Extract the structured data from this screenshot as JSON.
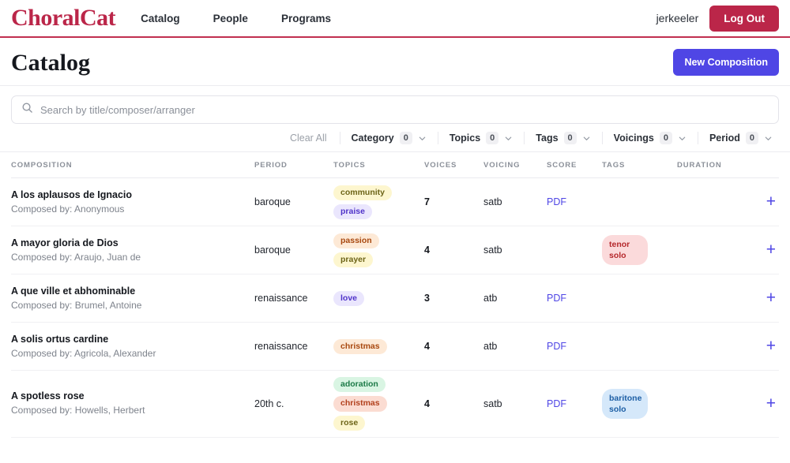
{
  "navbar": {
    "brand": "ChoralCat",
    "links": [
      {
        "label": "Catalog"
      },
      {
        "label": "People"
      },
      {
        "label": "Programs"
      }
    ],
    "username": "jerkeeler",
    "logout_label": "Log Out",
    "accent_color": "#bb2649"
  },
  "page": {
    "title": "Catalog",
    "new_button_label": "New Composition",
    "new_button_color": "#4f46e5"
  },
  "search": {
    "placeholder": "Search by title/composer/arranger",
    "value": "",
    "icon": "search-icon"
  },
  "filters": {
    "clear_all_label": "Clear All",
    "items": [
      {
        "label": "Category",
        "count": "0",
        "icon": "chevron-down-icon"
      },
      {
        "label": "Topics",
        "count": "0",
        "icon": "chevron-down-icon"
      },
      {
        "label": "Tags",
        "count": "0",
        "icon": "chevron-down-icon"
      },
      {
        "label": "Voicings",
        "count": "0",
        "icon": "chevron-down-icon"
      },
      {
        "label": "Period",
        "count": "0",
        "icon": "chevron-down-icon"
      }
    ]
  },
  "table": {
    "columns": [
      {
        "label": "COMPOSITION"
      },
      {
        "label": "PERIOD"
      },
      {
        "label": "TOPICS"
      },
      {
        "label": "VOICES"
      },
      {
        "label": "VOICING"
      },
      {
        "label": "SCORE"
      },
      {
        "label": "TAGS"
      },
      {
        "label": "DURATION"
      }
    ],
    "add_icon": "plus-icon",
    "rows": [
      {
        "title": "A los aplausos de Ignacio",
        "composer": "Composed by: Anonymous",
        "period": "baroque",
        "topics": [
          {
            "label": "community",
            "color": "chip-yellow"
          },
          {
            "label": "praise",
            "color": "chip-purple"
          }
        ],
        "voices": "7",
        "voicing": "satb",
        "score": "PDF",
        "tags": [],
        "duration": "",
        "add_label": "+"
      },
      {
        "title": "A mayor gloria de Dios",
        "composer": "Composed by: Araujo, Juan de",
        "period": "baroque",
        "topics": [
          {
            "label": "passion",
            "color": "chip-orange"
          },
          {
            "label": "prayer",
            "color": "chip-yellow"
          }
        ],
        "voices": "4",
        "voicing": "satb",
        "score": "",
        "tags": [
          {
            "label": "tenor solo",
            "color": "chip-pink"
          }
        ],
        "duration": "",
        "add_label": "+"
      },
      {
        "title": "A que ville et abhominable",
        "composer": "Composed by: Brumel, Antoine",
        "period": "renaissance",
        "topics": [
          {
            "label": "love",
            "color": "chip-purple"
          }
        ],
        "voices": "3",
        "voicing": "atb",
        "score": "PDF",
        "tags": [],
        "duration": "",
        "add_label": "+"
      },
      {
        "title": "A solis ortus cardine",
        "composer": "Composed by: Agricola, Alexander",
        "period": "renaissance",
        "topics": [
          {
            "label": "christmas",
            "color": "chip-orange"
          }
        ],
        "voices": "4",
        "voicing": "atb",
        "score": "PDF",
        "tags": [],
        "duration": "",
        "add_label": "+"
      },
      {
        "title": "A spotless rose",
        "composer": "Composed by: Howells, Herbert",
        "period": "20th c.",
        "topics": [
          {
            "label": "adoration",
            "color": "chip-green"
          },
          {
            "label": "christmas",
            "color": "chip-salmon"
          },
          {
            "label": "rose",
            "color": "chip-yellow"
          }
        ],
        "voices": "4",
        "voicing": "satb",
        "score": "PDF",
        "tags": [
          {
            "label": "baritone solo",
            "color": "chip-blue"
          }
        ],
        "duration": "",
        "add_label": "+"
      }
    ]
  }
}
